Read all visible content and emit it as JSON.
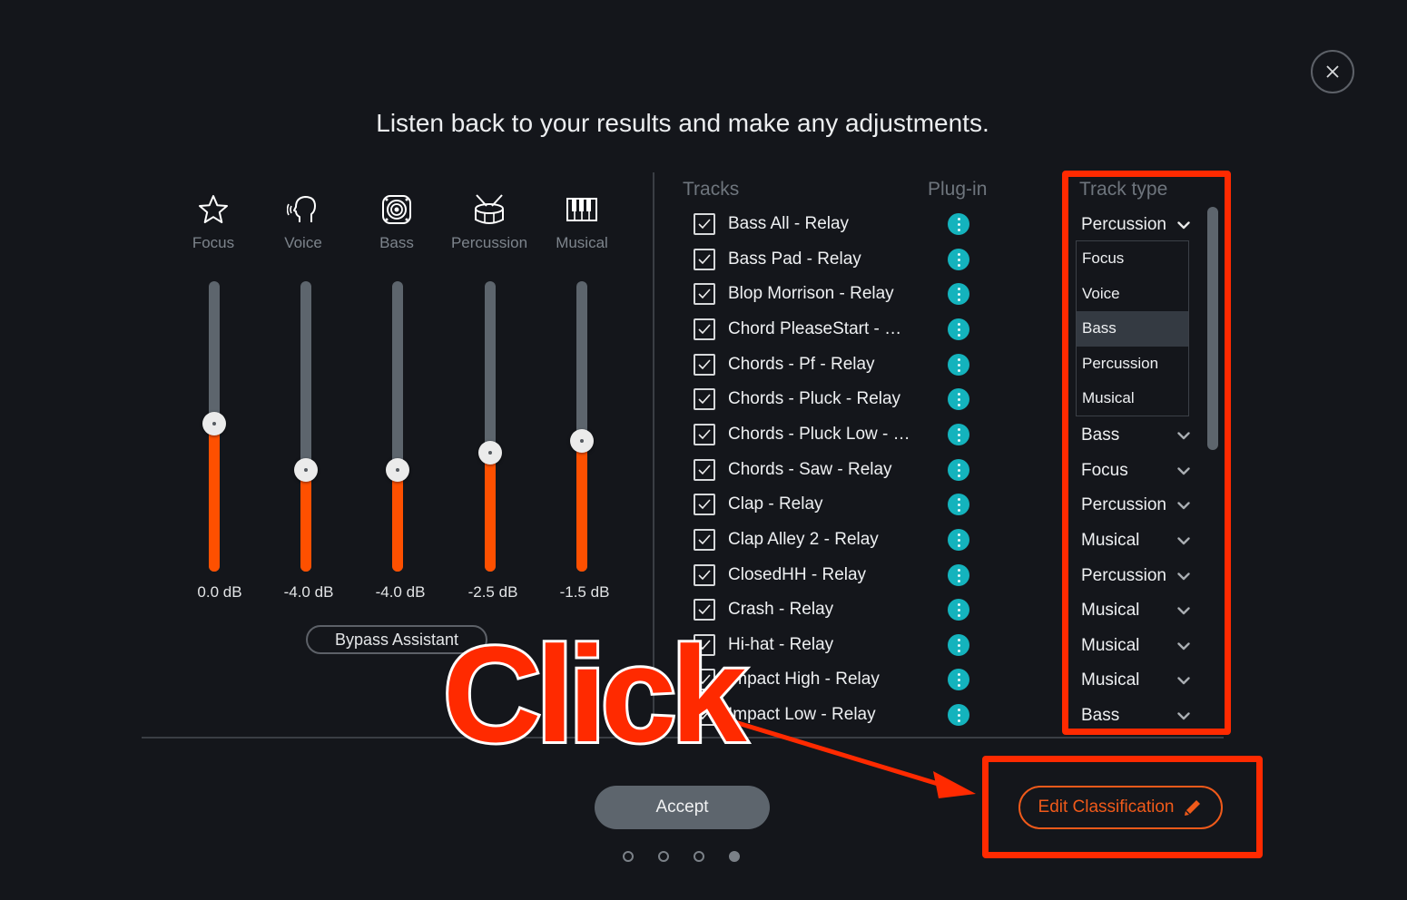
{
  "header": {
    "title": "Listen back to your results and make any adjustments.",
    "close_icon": "close-icon"
  },
  "faders": [
    {
      "label": "Focus",
      "icon": "star-icon",
      "value_db": 0.0,
      "display": "0.0 dB",
      "level": 0.51
    },
    {
      "label": "Voice",
      "icon": "voice-icon",
      "value_db": -4.0,
      "display": "-4.0 dB",
      "level": 0.35
    },
    {
      "label": "Bass",
      "icon": "speaker-icon",
      "value_db": -4.0,
      "display": "-4.0 dB",
      "level": 0.35
    },
    {
      "label": "Percussion",
      "icon": "drum-icon",
      "value_db": -2.5,
      "display": "-2.5 dB",
      "level": 0.41
    },
    {
      "label": "Musical",
      "icon": "piano-icon",
      "value_db": -1.5,
      "display": "-1.5 dB",
      "level": 0.45
    }
  ],
  "bypass_label": "Bypass Assistant",
  "tracks_panel": {
    "col_tracks": "Tracks",
    "col_plugin": "Plug-in",
    "col_type": "Track type",
    "rows": [
      {
        "name": "Bass All - Relay",
        "checked": true,
        "type": "Percussion"
      },
      {
        "name": "Bass Pad - Relay",
        "checked": true,
        "type": ""
      },
      {
        "name": "Blop Morrison - Relay",
        "checked": true,
        "type": ""
      },
      {
        "name": " Chord PleaseStart - …",
        "checked": true,
        "type": ""
      },
      {
        "name": "Chords - Pf - Relay",
        "checked": true,
        "type": ""
      },
      {
        "name": "Chords - Pluck - Relay",
        "checked": true,
        "type": ""
      },
      {
        "name": "Chords - Pluck Low - …",
        "checked": true,
        "type": "Bass"
      },
      {
        "name": "Chords - Saw - Relay",
        "checked": true,
        "type": "Focus"
      },
      {
        "name": "Clap - Relay",
        "checked": true,
        "type": "Percussion"
      },
      {
        "name": "Clap Alley 2 - Relay",
        "checked": true,
        "type": "Musical"
      },
      {
        "name": "ClosedHH - Relay",
        "checked": true,
        "type": "Percussion"
      },
      {
        "name": "Crash - Relay",
        "checked": true,
        "type": "Musical"
      },
      {
        "name": "Hi-hat - Relay",
        "checked": true,
        "type": "Musical"
      },
      {
        "name": "Impact High - Relay",
        "checked": true,
        "type": "Musical"
      },
      {
        "name": "Impact Low - Relay",
        "checked": true,
        "type": "Bass"
      }
    ],
    "dropdown_open": {
      "options": [
        "Focus",
        "Voice",
        "Bass",
        "Percussion",
        "Musical"
      ],
      "highlighted": "Bass"
    }
  },
  "footer": {
    "accept_label": "Accept",
    "edit_label": "Edit Classification",
    "pages": 4,
    "current_page": 4
  },
  "annotation": {
    "text": "Click",
    "color": "#ff2a00"
  },
  "colors": {
    "background": "#14161b",
    "accent_orange": "#fe5000",
    "plugin_teal": "#14b3bd",
    "edit_orange": "#f05a1a"
  }
}
